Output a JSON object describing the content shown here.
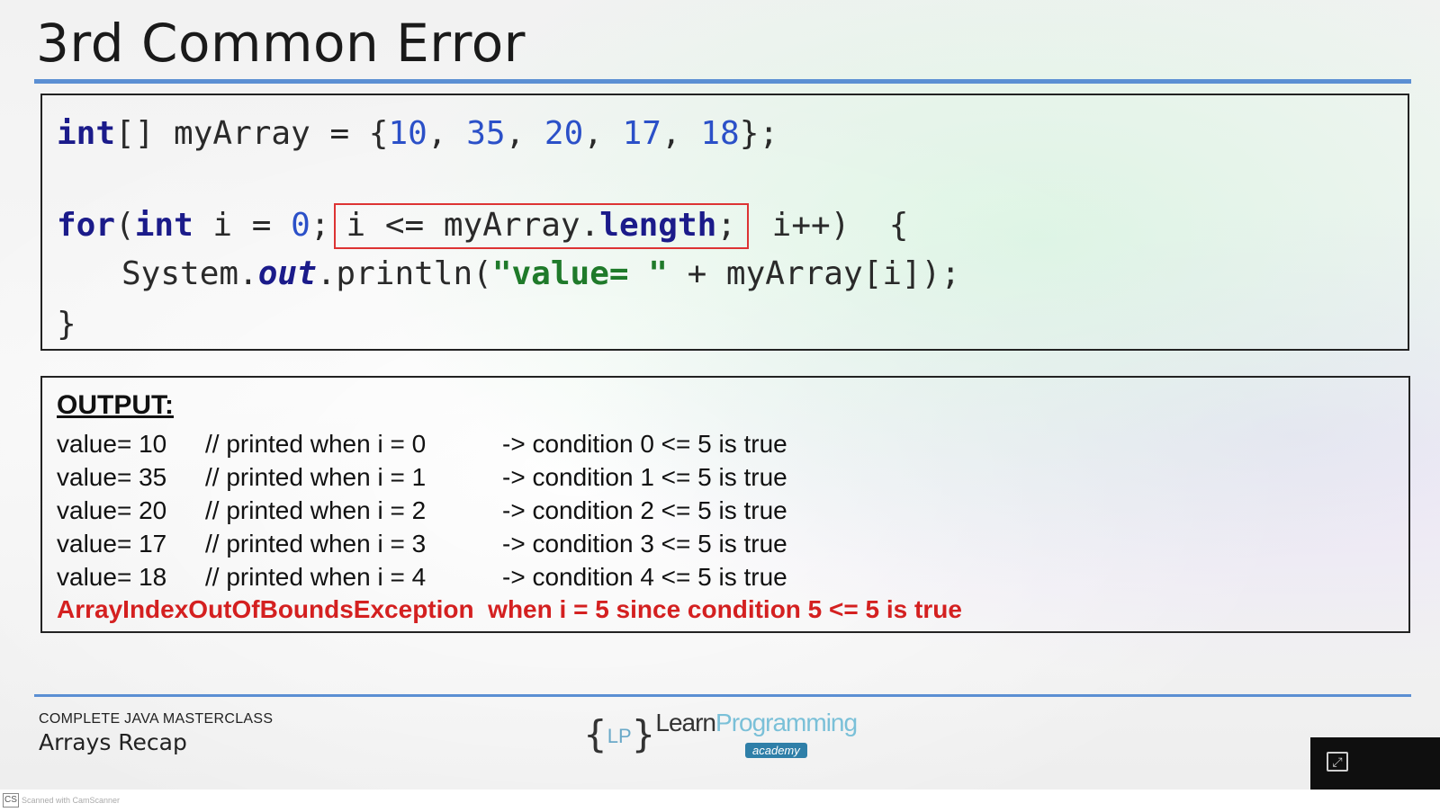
{
  "slide": {
    "title": "3rd Common Error",
    "footer": {
      "course": "COMPLETE JAVA MASTERCLASS",
      "lesson": "Arrays Recap"
    },
    "logo": {
      "brace_open": "{",
      "brace_close": "}",
      "initials": "LP",
      "learn": "Learn",
      "programming": "Programming",
      "academy": "academy"
    }
  },
  "code": {
    "line1": {
      "type": "int",
      "decl": "[] myArray = {",
      "values": [
        "10",
        "35",
        "20",
        "17",
        "18"
      ],
      "sep": ", ",
      "end": "};"
    },
    "line2": {
      "kw_for": "for",
      "paren": "(",
      "kw_int": "int",
      "init": " i = ",
      "zero": "0",
      "semi": ";",
      "cond_a": "i <= myArray.",
      "cond_b": "length",
      "cond_c": ";",
      "tail": " i++)  {"
    },
    "line3": {
      "a": "System.",
      "out": "out",
      "b": ".println(",
      "str": "\"value= \"",
      "c": " + myArray[i]);"
    },
    "line4": "}"
  },
  "output": {
    "title": "OUTPUT:",
    "rows": [
      {
        "value": "value= 10",
        "comment": "// printed when i = 0",
        "cond": "-> condition 0 <= 5 is true"
      },
      {
        "value": "value= 35",
        "comment": "// printed when i = 1",
        "cond": "-> condition 1 <= 5 is true"
      },
      {
        "value": "value= 20",
        "comment": "// printed when i = 2",
        "cond": "-> condition 2 <= 5 is true"
      },
      {
        "value": "value= 17",
        "comment": "// printed when i = 3",
        "cond": "-> condition 3 <= 5 is true"
      },
      {
        "value": "value= 18",
        "comment": "// printed when i = 4",
        "cond": "-> condition 4 <= 5 is true"
      }
    ],
    "error": "ArrayIndexOutOfBoundsException  when i = 5 since condition 5 <= 5 is true"
  },
  "player": {
    "fullscreen_icon": "fullscreen-icon"
  },
  "scanner": {
    "badge": "CS",
    "text": "Scanned with CamScanner"
  },
  "colors": {
    "accent_rule": "#5b8fd3",
    "keyword": "#1b1b8a",
    "number": "#2b50c8",
    "string": "#1f7a2a",
    "highlight_border": "#dd3333",
    "error": "#d42020"
  }
}
